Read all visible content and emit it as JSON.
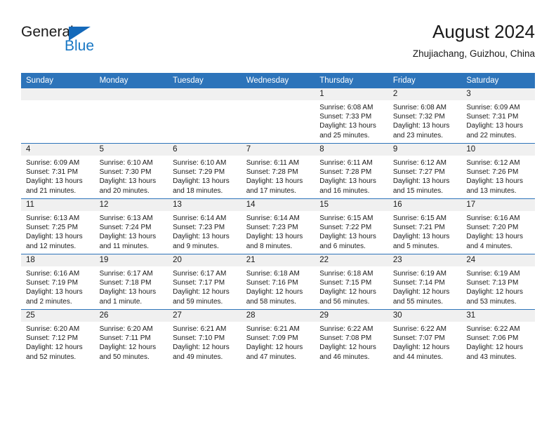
{
  "brand": {
    "name_top": "General",
    "name_bottom": "Blue",
    "flag_color": "#1469ba",
    "blue_text_color": "#1877c4"
  },
  "header": {
    "title": "August 2024",
    "location": "Zhujiachang, Guizhou, China"
  },
  "theme": {
    "header_blue": "#2d74ba",
    "daynum_band": "#f0f0f0",
    "text": "#1a1a1a"
  },
  "weekday_headers": [
    "Sunday",
    "Monday",
    "Tuesday",
    "Wednesday",
    "Thursday",
    "Friday",
    "Saturday"
  ],
  "weeks": [
    [
      {
        "day": "",
        "lines": []
      },
      {
        "day": "",
        "lines": []
      },
      {
        "day": "",
        "lines": []
      },
      {
        "day": "",
        "lines": []
      },
      {
        "day": "1",
        "lines": [
          "Sunrise: 6:08 AM",
          "Sunset: 7:33 PM",
          "Daylight: 13 hours",
          "and 25 minutes."
        ]
      },
      {
        "day": "2",
        "lines": [
          "Sunrise: 6:08 AM",
          "Sunset: 7:32 PM",
          "Daylight: 13 hours",
          "and 23 minutes."
        ]
      },
      {
        "day": "3",
        "lines": [
          "Sunrise: 6:09 AM",
          "Sunset: 7:31 PM",
          "Daylight: 13 hours",
          "and 22 minutes."
        ]
      }
    ],
    [
      {
        "day": "4",
        "lines": [
          "Sunrise: 6:09 AM",
          "Sunset: 7:31 PM",
          "Daylight: 13 hours",
          "and 21 minutes."
        ]
      },
      {
        "day": "5",
        "lines": [
          "Sunrise: 6:10 AM",
          "Sunset: 7:30 PM",
          "Daylight: 13 hours",
          "and 20 minutes."
        ]
      },
      {
        "day": "6",
        "lines": [
          "Sunrise: 6:10 AM",
          "Sunset: 7:29 PM",
          "Daylight: 13 hours",
          "and 18 minutes."
        ]
      },
      {
        "day": "7",
        "lines": [
          "Sunrise: 6:11 AM",
          "Sunset: 7:28 PM",
          "Daylight: 13 hours",
          "and 17 minutes."
        ]
      },
      {
        "day": "8",
        "lines": [
          "Sunrise: 6:11 AM",
          "Sunset: 7:28 PM",
          "Daylight: 13 hours",
          "and 16 minutes."
        ]
      },
      {
        "day": "9",
        "lines": [
          "Sunrise: 6:12 AM",
          "Sunset: 7:27 PM",
          "Daylight: 13 hours",
          "and 15 minutes."
        ]
      },
      {
        "day": "10",
        "lines": [
          "Sunrise: 6:12 AM",
          "Sunset: 7:26 PM",
          "Daylight: 13 hours",
          "and 13 minutes."
        ]
      }
    ],
    [
      {
        "day": "11",
        "lines": [
          "Sunrise: 6:13 AM",
          "Sunset: 7:25 PM",
          "Daylight: 13 hours",
          "and 12 minutes."
        ]
      },
      {
        "day": "12",
        "lines": [
          "Sunrise: 6:13 AM",
          "Sunset: 7:24 PM",
          "Daylight: 13 hours",
          "and 11 minutes."
        ]
      },
      {
        "day": "13",
        "lines": [
          "Sunrise: 6:14 AM",
          "Sunset: 7:23 PM",
          "Daylight: 13 hours",
          "and 9 minutes."
        ]
      },
      {
        "day": "14",
        "lines": [
          "Sunrise: 6:14 AM",
          "Sunset: 7:23 PM",
          "Daylight: 13 hours",
          "and 8 minutes."
        ]
      },
      {
        "day": "15",
        "lines": [
          "Sunrise: 6:15 AM",
          "Sunset: 7:22 PM",
          "Daylight: 13 hours",
          "and 6 minutes."
        ]
      },
      {
        "day": "16",
        "lines": [
          "Sunrise: 6:15 AM",
          "Sunset: 7:21 PM",
          "Daylight: 13 hours",
          "and 5 minutes."
        ]
      },
      {
        "day": "17",
        "lines": [
          "Sunrise: 6:16 AM",
          "Sunset: 7:20 PM",
          "Daylight: 13 hours",
          "and 4 minutes."
        ]
      }
    ],
    [
      {
        "day": "18",
        "lines": [
          "Sunrise: 6:16 AM",
          "Sunset: 7:19 PM",
          "Daylight: 13 hours",
          "and 2 minutes."
        ]
      },
      {
        "day": "19",
        "lines": [
          "Sunrise: 6:17 AM",
          "Sunset: 7:18 PM",
          "Daylight: 13 hours",
          "and 1 minute."
        ]
      },
      {
        "day": "20",
        "lines": [
          "Sunrise: 6:17 AM",
          "Sunset: 7:17 PM",
          "Daylight: 12 hours",
          "and 59 minutes."
        ]
      },
      {
        "day": "21",
        "lines": [
          "Sunrise: 6:18 AM",
          "Sunset: 7:16 PM",
          "Daylight: 12 hours",
          "and 58 minutes."
        ]
      },
      {
        "day": "22",
        "lines": [
          "Sunrise: 6:18 AM",
          "Sunset: 7:15 PM",
          "Daylight: 12 hours",
          "and 56 minutes."
        ]
      },
      {
        "day": "23",
        "lines": [
          "Sunrise: 6:19 AM",
          "Sunset: 7:14 PM",
          "Daylight: 12 hours",
          "and 55 minutes."
        ]
      },
      {
        "day": "24",
        "lines": [
          "Sunrise: 6:19 AM",
          "Sunset: 7:13 PM",
          "Daylight: 12 hours",
          "and 53 minutes."
        ]
      }
    ],
    [
      {
        "day": "25",
        "lines": [
          "Sunrise: 6:20 AM",
          "Sunset: 7:12 PM",
          "Daylight: 12 hours",
          "and 52 minutes."
        ]
      },
      {
        "day": "26",
        "lines": [
          "Sunrise: 6:20 AM",
          "Sunset: 7:11 PM",
          "Daylight: 12 hours",
          "and 50 minutes."
        ]
      },
      {
        "day": "27",
        "lines": [
          "Sunrise: 6:21 AM",
          "Sunset: 7:10 PM",
          "Daylight: 12 hours",
          "and 49 minutes."
        ]
      },
      {
        "day": "28",
        "lines": [
          "Sunrise: 6:21 AM",
          "Sunset: 7:09 PM",
          "Daylight: 12 hours",
          "and 47 minutes."
        ]
      },
      {
        "day": "29",
        "lines": [
          "Sunrise: 6:22 AM",
          "Sunset: 7:08 PM",
          "Daylight: 12 hours",
          "and 46 minutes."
        ]
      },
      {
        "day": "30",
        "lines": [
          "Sunrise: 6:22 AM",
          "Sunset: 7:07 PM",
          "Daylight: 12 hours",
          "and 44 minutes."
        ]
      },
      {
        "day": "31",
        "lines": [
          "Sunrise: 6:22 AM",
          "Sunset: 7:06 PM",
          "Daylight: 12 hours",
          "and 43 minutes."
        ]
      }
    ]
  ]
}
